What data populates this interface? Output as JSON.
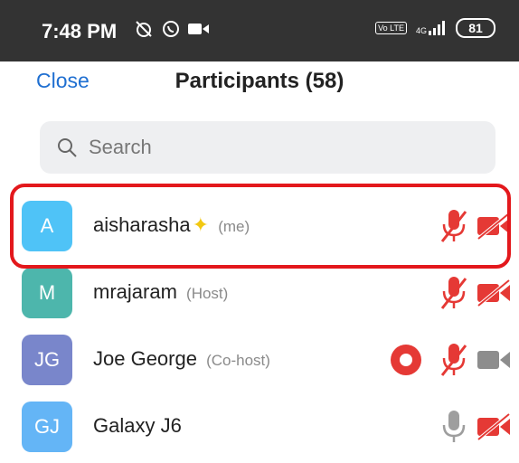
{
  "status_bar": {
    "time": "7:48 PM",
    "battery": "81",
    "network": "4G",
    "volte": "Vo LTE"
  },
  "header": {
    "close_label": "Close",
    "title": "Participants (58)"
  },
  "search": {
    "placeholder": "Search"
  },
  "participants": [
    {
      "initials": "A",
      "name": "aisharasha",
      "role": "(me)",
      "avatar_color": "#4fc3f7",
      "mic": "muted",
      "video": "off",
      "sparkle": true
    },
    {
      "initials": "M",
      "name": "mrajaram",
      "role": "(Host)",
      "avatar_color": "#4db6ac",
      "mic": "muted",
      "video": "off"
    },
    {
      "initials": "JG",
      "name": "Joe George",
      "role": "(Co-host)",
      "avatar_color": "#7986cb",
      "mic": "muted",
      "video": "on",
      "recording": true
    },
    {
      "initials": "GJ",
      "name": "Galaxy J6",
      "role": "",
      "avatar_color": "#64b5f6",
      "mic": "on",
      "video": "off"
    }
  ],
  "colors": {
    "accent": "#1f6fd1",
    "muted_red": "#e53935",
    "inactive_gray": "#9e9e9e",
    "highlight_border": "#e3181c"
  }
}
